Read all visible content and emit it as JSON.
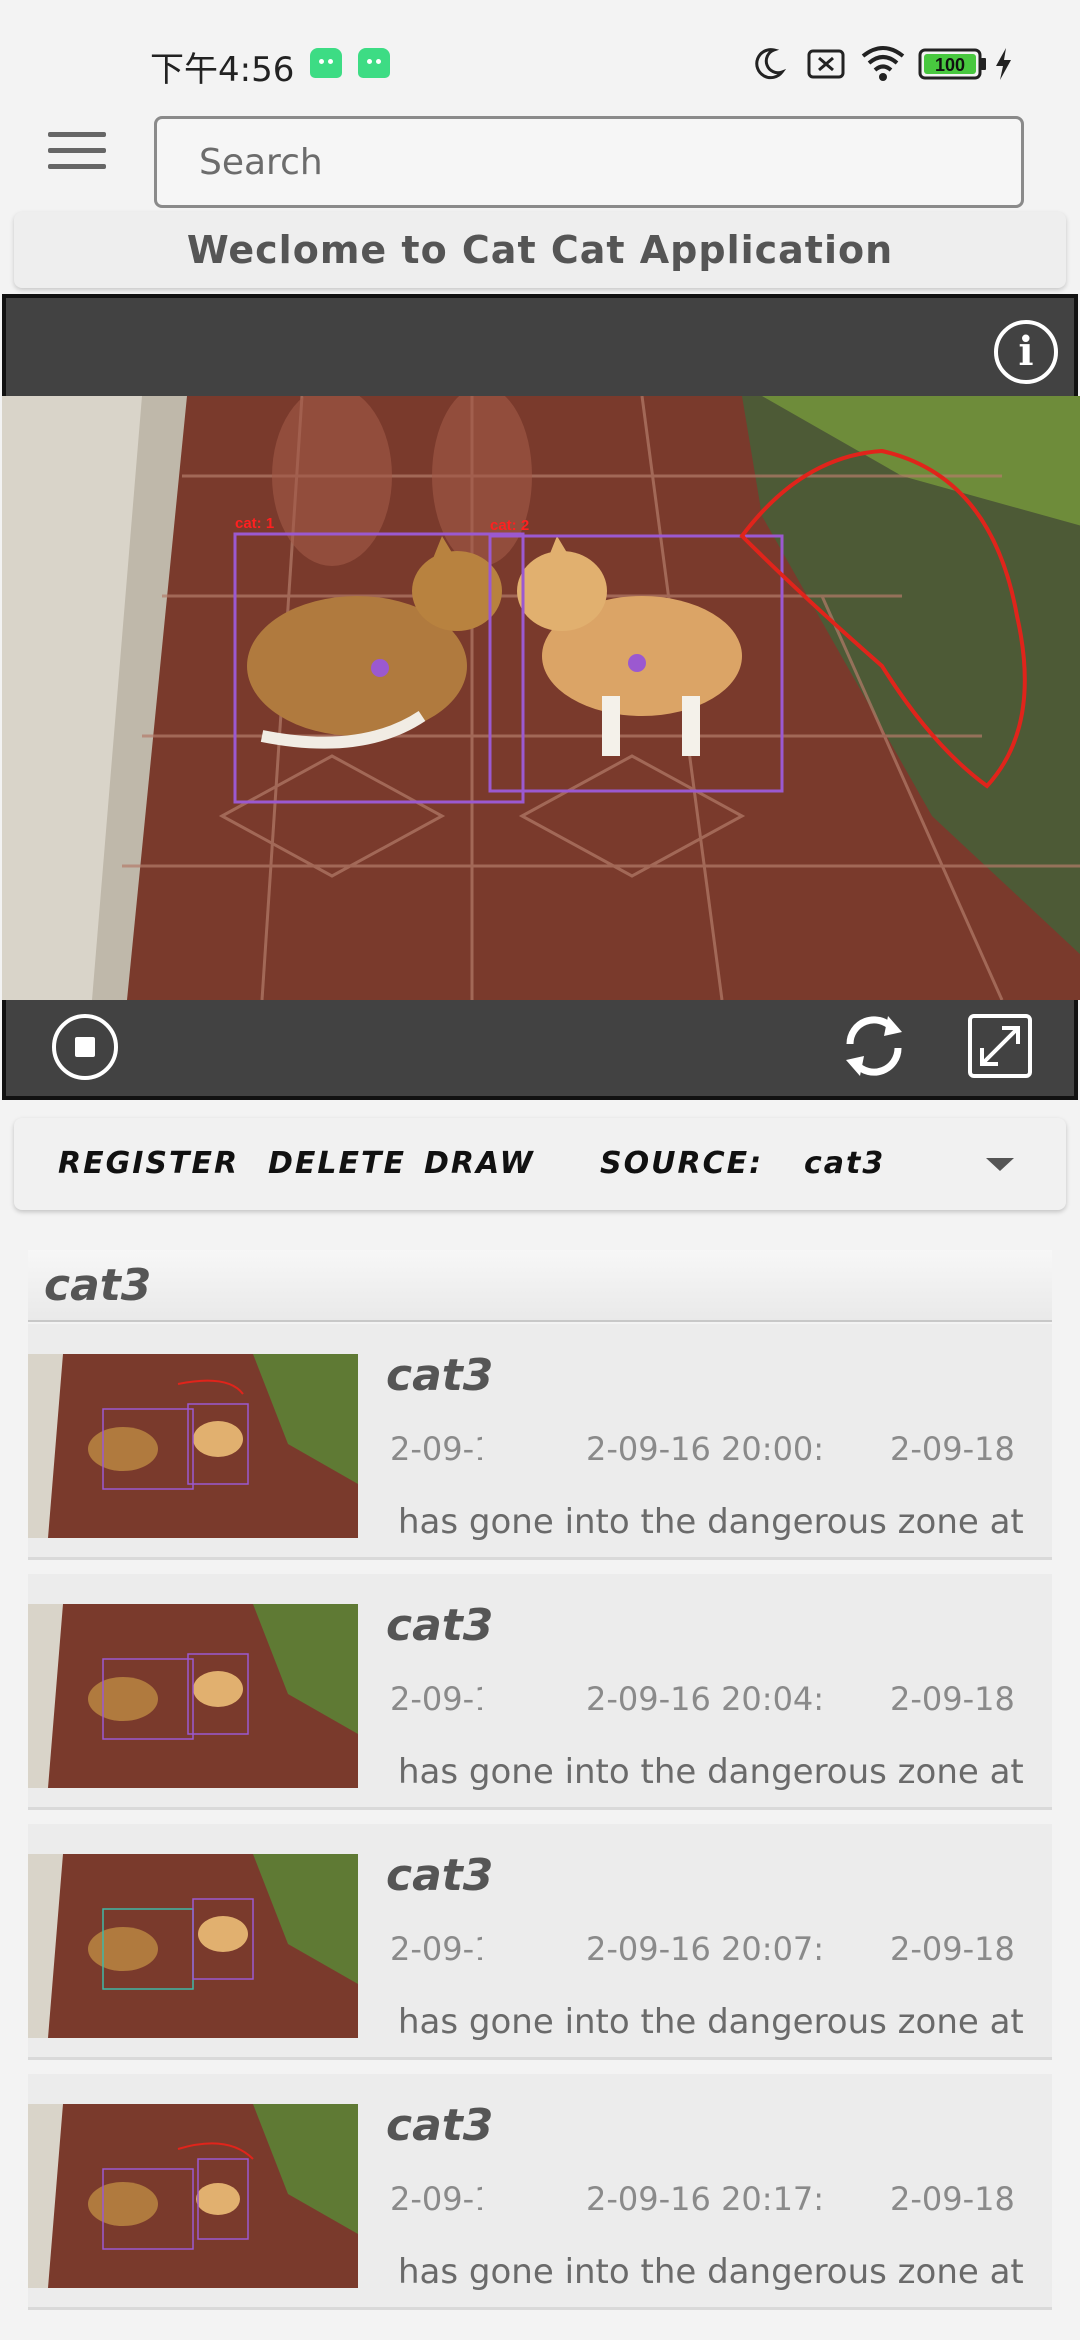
{
  "status_bar": {
    "time": "下午4:56",
    "battery": "100",
    "icons": [
      "android-icon",
      "android-icon",
      "moon-icon",
      "sim-off-icon",
      "wifi-icon",
      "battery-icon",
      "charging-icon"
    ]
  },
  "header": {
    "menu_icon": "hamburger-menu-icon",
    "search_placeholder": "Search"
  },
  "banner": {
    "title": "Weclome to Cat Cat Application"
  },
  "player": {
    "info_icon": "info-icon",
    "stop_icon": "stop-icon",
    "refresh_icon": "refresh-icon",
    "fullscreen_icon": "fullscreen-icon",
    "detections": [
      {
        "label": "cat: 1"
      },
      {
        "label": "cat: 2"
      }
    ]
  },
  "toolbar": {
    "register": "REGISTER",
    "delete": "DELETE",
    "draw": "DRAW",
    "source_label": "SOURCE:",
    "source_value": "cat3"
  },
  "list": {
    "header": "cat3",
    "items": [
      {
        "title": "cat3",
        "time_a": "2-09-1",
        "time_b": "2-09-16 20:00:",
        "time_c": "2-09-18",
        "message": "has gone into the dangerous zone at"
      },
      {
        "title": "cat3",
        "time_a": "2-09-1",
        "time_b": "2-09-16 20:04:",
        "time_c": "2-09-18",
        "message": "has gone into the dangerous zone at"
      },
      {
        "title": "cat3",
        "time_a": "2-09-1",
        "time_b": "2-09-16 20:07:",
        "time_c": "2-09-18",
        "message": "has gone into the dangerous zone at"
      },
      {
        "title": "cat3",
        "time_a": "2-09-1",
        "time_b": "2-09-16 20:17:",
        "time_c": "2-09-18",
        "message": "has gone into the dangerous zone at"
      }
    ]
  },
  "colors": {
    "background": "#f3f3f3",
    "player_bg": "#424242",
    "detection_box": "#9b59d0",
    "zone_line": "#e0241b",
    "title_text": "#555555"
  }
}
